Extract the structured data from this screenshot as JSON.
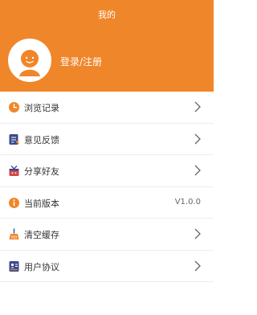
{
  "header": {
    "title": "我的",
    "login_label": "登录/注册",
    "background": "#f0862a"
  },
  "menu": [
    {
      "label": "浏览记录",
      "icon": "clock-icon",
      "icon_color": "#f0862a",
      "chevron": true
    },
    {
      "label": "意见反馈",
      "icon": "feedback-icon",
      "icon_color": "#3a4a8c",
      "chevron": true
    },
    {
      "label": "分享好友",
      "icon": "gift-icon",
      "icon_color": "#d64545",
      "chevron": true
    },
    {
      "label": "当前版本",
      "icon": "info-icon",
      "icon_color": "#f0862a",
      "value": "V1.0.0",
      "chevron": false
    },
    {
      "label": "清空缓存",
      "icon": "broom-icon",
      "icon_color": "#f0862a",
      "chevron": true
    },
    {
      "label": "用户协议",
      "icon": "agreement-icon",
      "icon_color": "#3a4a8c",
      "chevron": true
    }
  ]
}
